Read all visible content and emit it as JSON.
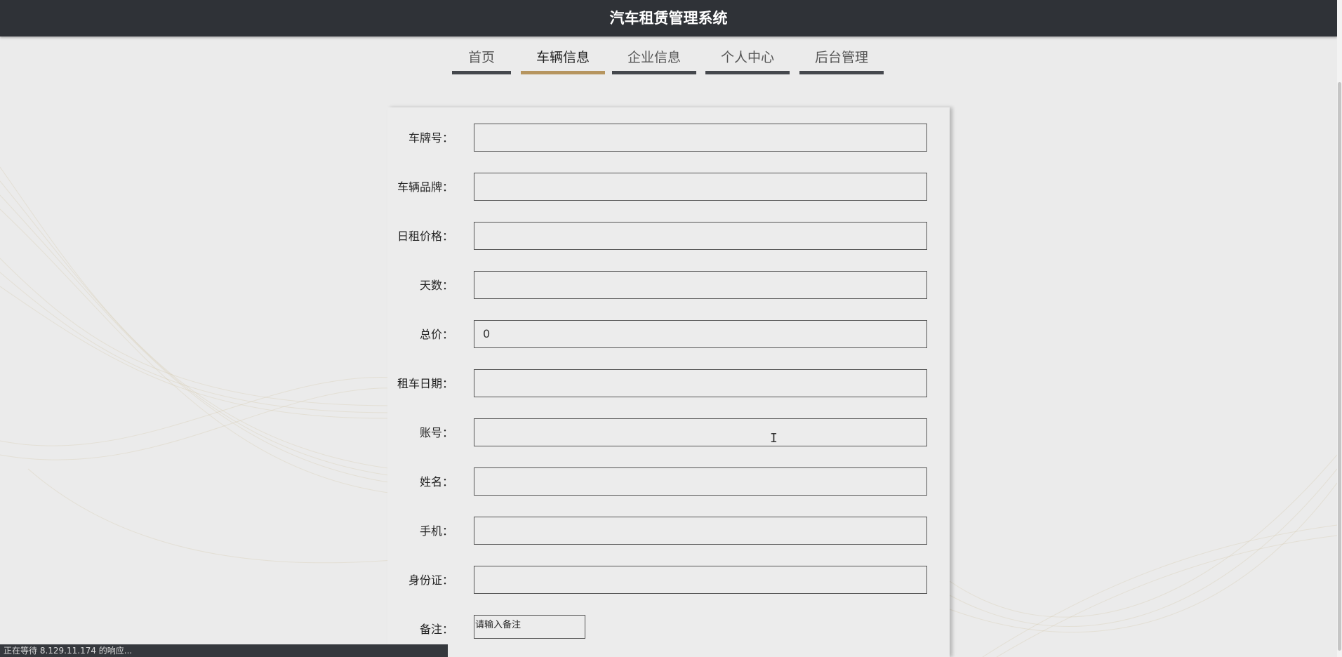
{
  "header": {
    "title": "汽车租赁管理系统"
  },
  "nav": {
    "tabs": [
      {
        "label": "首页",
        "active": false
      },
      {
        "label": "车辆信息",
        "active": true
      },
      {
        "label": "企业信息",
        "active": false
      },
      {
        "label": "个人中心",
        "active": false
      },
      {
        "label": "后台管理",
        "active": false
      }
    ]
  },
  "form": {
    "fields": [
      {
        "label": "车牌号：",
        "value": ""
      },
      {
        "label": "车辆品牌：",
        "value": ""
      },
      {
        "label": "日租价格：",
        "value": ""
      },
      {
        "label": "天数：",
        "value": ""
      },
      {
        "label": "总价：",
        "value": "0"
      },
      {
        "label": "租车日期：",
        "value": ""
      },
      {
        "label": "账号：",
        "value": ""
      },
      {
        "label": "姓名：",
        "value": ""
      },
      {
        "label": "手机：",
        "value": ""
      },
      {
        "label": "身份证：",
        "value": ""
      }
    ],
    "remark": {
      "label": "备注：",
      "placeholder": "请输入备注"
    }
  },
  "status_bar": {
    "text": "正在等待 8.129.11.174 的响应..."
  },
  "colors": {
    "header_bg": "#2f3237",
    "tab_active": "#b6955f",
    "tab_inactive": "#45484d",
    "page_bg": "#ebebeb"
  }
}
